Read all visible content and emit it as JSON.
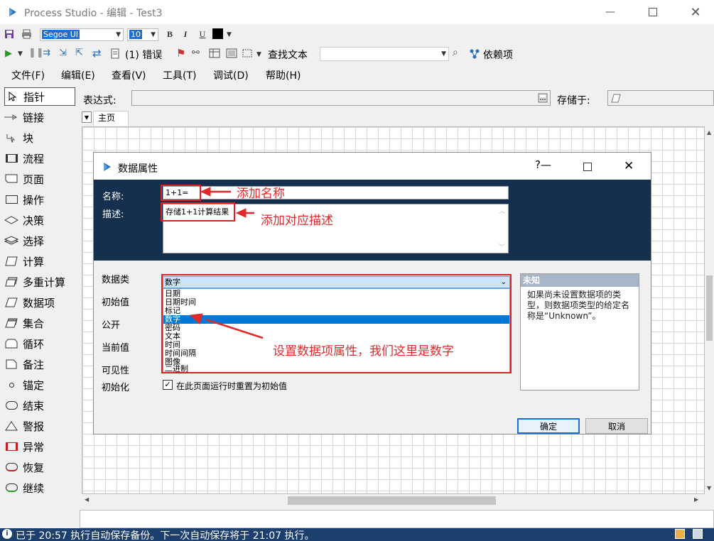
{
  "window": {
    "app_name": "Process Studio",
    "title_suffix": " - 编辑 - Test3"
  },
  "format_toolbar": {
    "font_name": "Segoe UI",
    "font_size": "10",
    "bold": "B",
    "italic": "I",
    "underline": "U"
  },
  "run_toolbar": {
    "errors": "(1) 错误",
    "find_text": "查找文本",
    "dependencies": "依赖项"
  },
  "menu": [
    "文件(F)",
    "编辑(E)",
    "查看(V)",
    "工具(T)",
    "调试(D)",
    "帮助(H)"
  ],
  "palette": [
    {
      "label": "指针",
      "icon": "pointer-icon"
    },
    {
      "label": "链接",
      "icon": "link-icon"
    },
    {
      "label": "块",
      "icon": "block-icon"
    },
    {
      "label": "流程",
      "icon": "process-icon"
    },
    {
      "label": "页面",
      "icon": "page-icon"
    },
    {
      "label": "操作",
      "icon": "action-icon"
    },
    {
      "label": "决策",
      "icon": "decision-icon"
    },
    {
      "label": "选择",
      "icon": "choice-icon"
    },
    {
      "label": "计算",
      "icon": "calculation-icon"
    },
    {
      "label": "多重计算",
      "icon": "multi-calc-icon"
    },
    {
      "label": "数据项",
      "icon": "data-item-icon"
    },
    {
      "label": "集合",
      "icon": "collection-icon"
    },
    {
      "label": "循环",
      "icon": "loop-icon"
    },
    {
      "label": "备注",
      "icon": "note-icon"
    },
    {
      "label": "锚定",
      "icon": "anchor-icon"
    },
    {
      "label": "结束",
      "icon": "end-icon"
    },
    {
      "label": "警报",
      "icon": "alert-icon"
    },
    {
      "label": "异常",
      "icon": "exception-icon"
    },
    {
      "label": "恢复",
      "icon": "recover-icon"
    },
    {
      "label": "继续",
      "icon": "resume-icon"
    }
  ],
  "expression_bar": {
    "expression_label": "表达式:",
    "stored_in_label": "存储于:"
  },
  "tabs": {
    "main": "主页"
  },
  "dialog": {
    "title": "数据属性",
    "help": "?",
    "name_label": "名称:",
    "name_value": "1+1=",
    "desc_label": "描述:",
    "desc_value": "存储1+1计算结果",
    "type_label": "数据类",
    "initial_label": "初始值",
    "public_label": "公开",
    "current_label": "当前值",
    "visibility_label": "可见性",
    "init_label": "初始化",
    "type_value": "数字",
    "type_options": [
      "日期",
      "日期时间",
      "标记",
      "数字",
      "密码",
      "文本",
      "时间",
      "时间间隔",
      "图像",
      "二进制"
    ],
    "reset_checkbox": "在此页面运行时重置为初始值",
    "info_title": "未知",
    "info_body": "如果尚未设置数据项的类型，则数据项类型的给定名称是“Unknown”。",
    "ok": "确定",
    "cancel": "取消"
  },
  "annotations": {
    "add_name": "添加名称",
    "add_desc": "添加对应描述",
    "set_type": "设置数据项属性，我们这里是数字"
  },
  "status": {
    "text": "已于 20:57 执行自动保存备份。下一次自动保存将于 21:07 执行。"
  },
  "colors": {
    "header_bg": "#15304e",
    "status_bg": "#1c3f6e",
    "annotation_red": "#e02a2a",
    "selection_blue": "#0078d7"
  }
}
